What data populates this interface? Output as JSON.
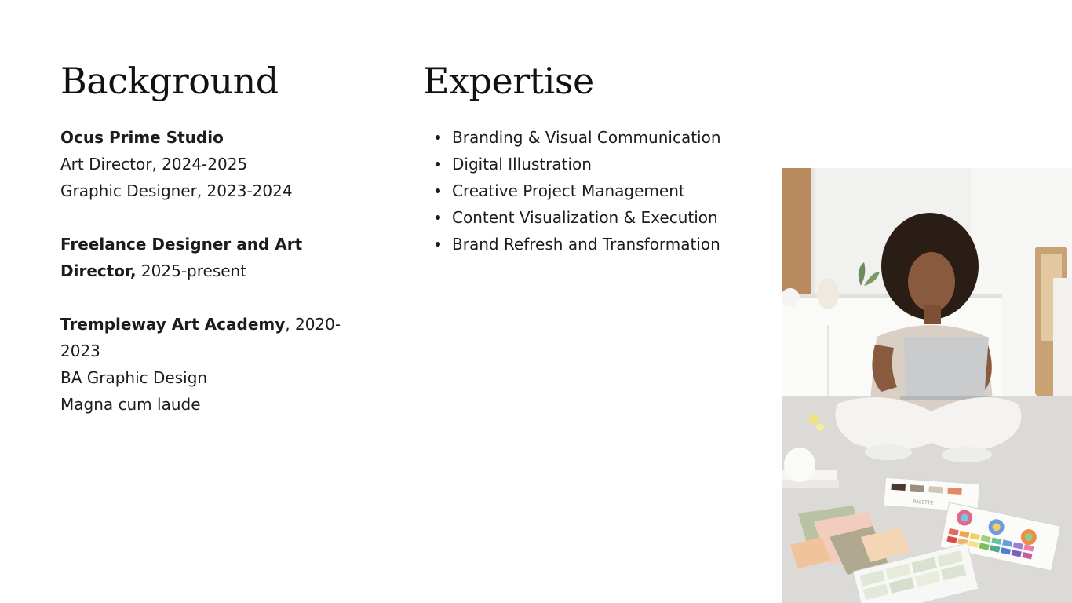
{
  "background": {
    "heading": "Background",
    "entries": [
      {
        "title": "Ocus Prime Studio",
        "title_suffix": "",
        "lines": [
          "Art Director, 2024-2025",
          "Graphic Designer, 2023-2024"
        ]
      },
      {
        "title": "Freelance Designer and Art Director,",
        "title_suffix": " 2025-present",
        "lines": []
      },
      {
        "title": "Trempleway Art Academy",
        "title_suffix": ", 2020-2023",
        "lines": [
          "BA Graphic Design",
          "Magna cum laude"
        ]
      }
    ]
  },
  "expertise": {
    "heading": "Expertise",
    "items": [
      "Branding & Visual Communication",
      "Digital Illustration",
      "Creative Project Management",
      "Content Visualization & Execution",
      "Brand Refresh and Transformation"
    ]
  },
  "photo": {
    "subject": "woman sitting on floor with laptop and color palette swatches",
    "palette_card_label": "PALETTE",
    "colors": {
      "wall": "#f1f1ef",
      "floor": "#dcdad6",
      "shirt": "#d9cfc4",
      "pants": "#f4f3f1",
      "laptop": "#c9cbcd",
      "cork": "#b88a5e",
      "hair": "#2a1d16",
      "skin": "#8a5a3e"
    }
  }
}
